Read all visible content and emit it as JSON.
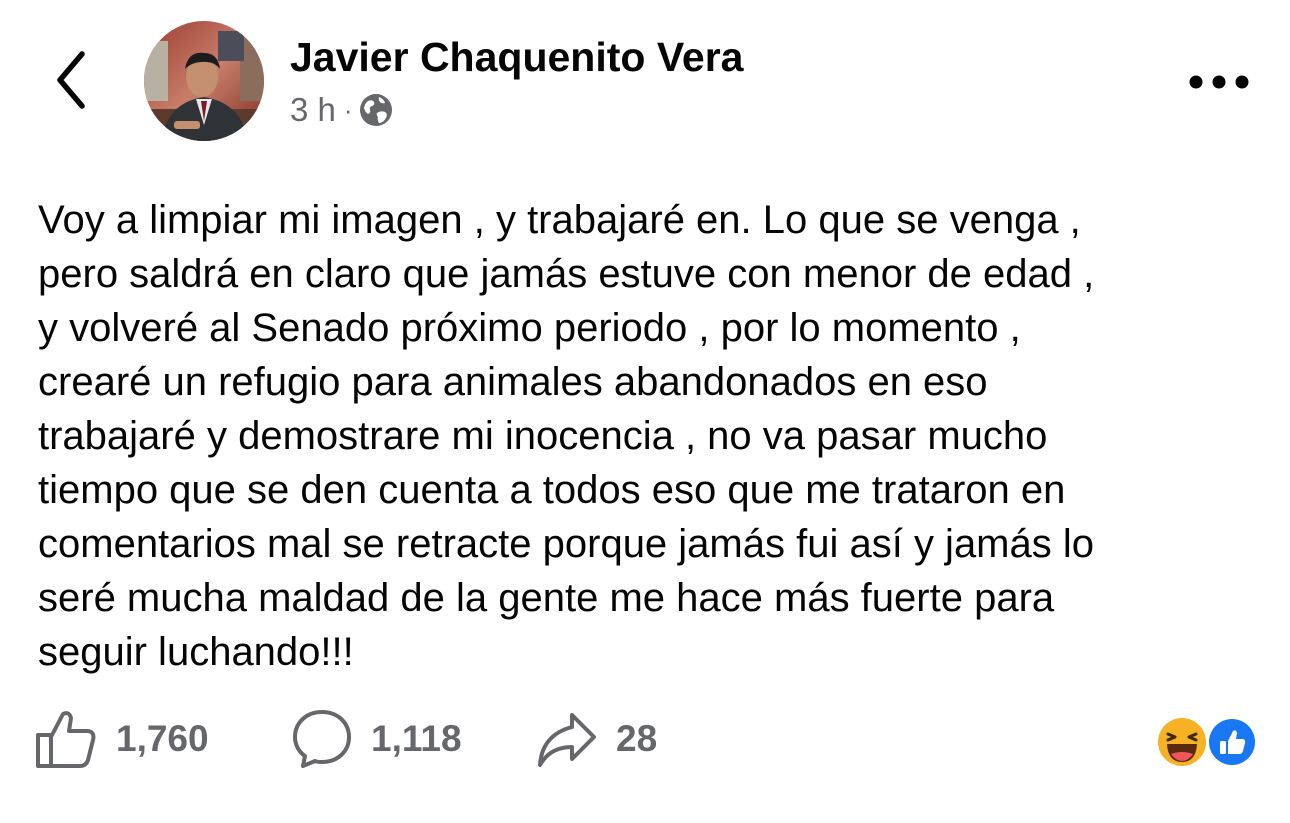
{
  "header": {
    "back_icon": "chevron-left-icon",
    "author_name": "Javier Chaquenito Vera",
    "timestamp": "3 h",
    "separator": "·",
    "audience_icon": "globe-icon",
    "more_icon": "more-horizontal-icon"
  },
  "post": {
    "text": "Voy a limpiar mi imagen , y trabajaré en. Lo que se venga ,\npero saldrá en claro que jamás estuve con menor de edad ,\ny volveré al Senado próximo periodo , por lo momento ,\ncrearé un refugio para animales abandonados en eso\ntrabajaré y demostrare mi inocencia , no va pasar mucho\ntiempo que se den cuenta a todos eso que me trataron en\ncomentarios mal se retracte porque jamás fui así y jamás lo\nseré mucha maldad de la gente me hace más fuerte para\nseguir luchando!!!"
  },
  "actions": {
    "like_count": "1,760",
    "comment_count": "1,118",
    "share_count": "28"
  },
  "reactions": [
    "haha",
    "like"
  ],
  "colors": {
    "text": "#050505",
    "secondary_text": "#65676b",
    "like_blue": "#1877f2",
    "haha_yellow": "#f7b125"
  }
}
